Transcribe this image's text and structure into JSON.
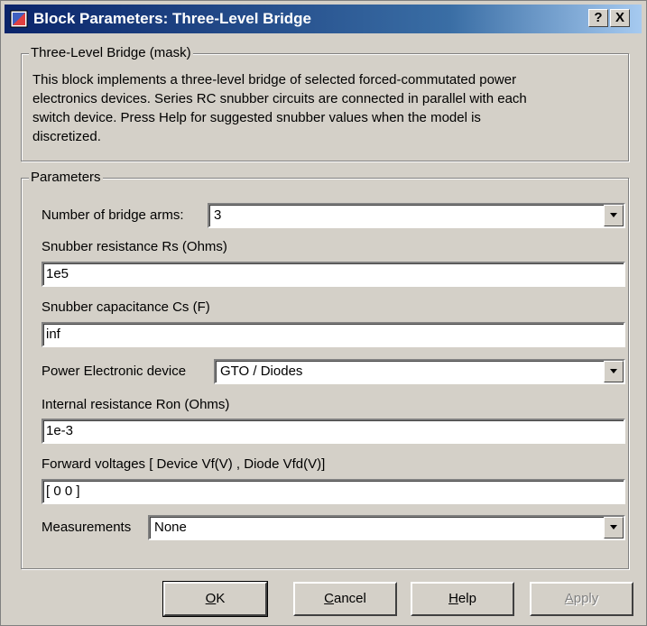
{
  "window": {
    "title": "Block Parameters: Three-Level Bridge"
  },
  "titlebar_buttons": {
    "help": "?",
    "close": "X"
  },
  "mask_group": {
    "legend": "Three-Level Bridge (mask)",
    "description_lines": [
      "This block implements a three-level bridge of selected forced-commutated power",
      "electronics devices.  Series RC snubber circuits are connected in parallel with each",
      "switch device.  Press Help for suggested snubber values when the model is",
      "discretized."
    ]
  },
  "parameters": {
    "legend": "Parameters",
    "bridge_arms": {
      "label": "Number of bridge arms:",
      "value": "3"
    },
    "snubber_resistance": {
      "label": "Snubber resistance Rs (Ohms)",
      "value": "1e5"
    },
    "snubber_capacitance": {
      "label": "Snubber capacitance Cs (F)",
      "value": "inf"
    },
    "power_device": {
      "label": "Power Electronic device",
      "value": "GTO / Diodes"
    },
    "internal_resistance": {
      "label": "Internal resistance Ron (Ohms)",
      "value": "1e-3"
    },
    "forward_voltages": {
      "label": "Forward voltages  [ Device Vf(V) , Diode Vfd(V)]",
      "value": "[ 0 0 ]"
    },
    "measurements": {
      "label": "Measurements",
      "value": "None"
    }
  },
  "buttons": {
    "ok": {
      "first": "O",
      "rest": "K"
    },
    "cancel": {
      "first": "C",
      "rest": "ancel"
    },
    "help": {
      "first": "H",
      "rest": "elp"
    },
    "apply": {
      "first": "A",
      "rest": "pply"
    }
  },
  "icons": {
    "app": "simulink-block-icon",
    "dropdown": "chevron-down-icon"
  }
}
